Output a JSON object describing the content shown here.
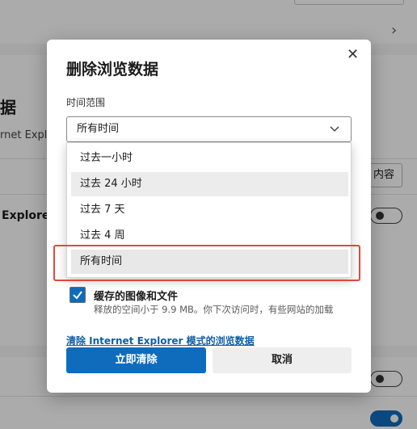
{
  "background": {
    "section_heading": "据",
    "section_subtext": "rnet Explo",
    "item_label": "Explorer",
    "clear_button_label": "内容"
  },
  "dialog": {
    "title": "删除浏览数据",
    "close_icon": "close-icon",
    "time_range_label": "时间范围",
    "time_range_selected": "所有时间",
    "time_range_options": [
      "过去一小时",
      "过去 24 小时",
      "过去 7 天",
      "过去 4 周",
      "所有时间"
    ],
    "hovered_option": "过去 24 小时",
    "cache_checkbox": {
      "checked": true,
      "title": "缓存的图像和文件",
      "description": "释放的空间小于 9.9 MB。你下次访问时，有些网站的加载"
    },
    "ie_link": "清除 Internet Explorer 模式的浏览数据",
    "clear_now_label": "立即清除",
    "cancel_label": "取消"
  },
  "colors": {
    "accent": "#0f6cbd",
    "highlight_border": "#e2483a"
  }
}
